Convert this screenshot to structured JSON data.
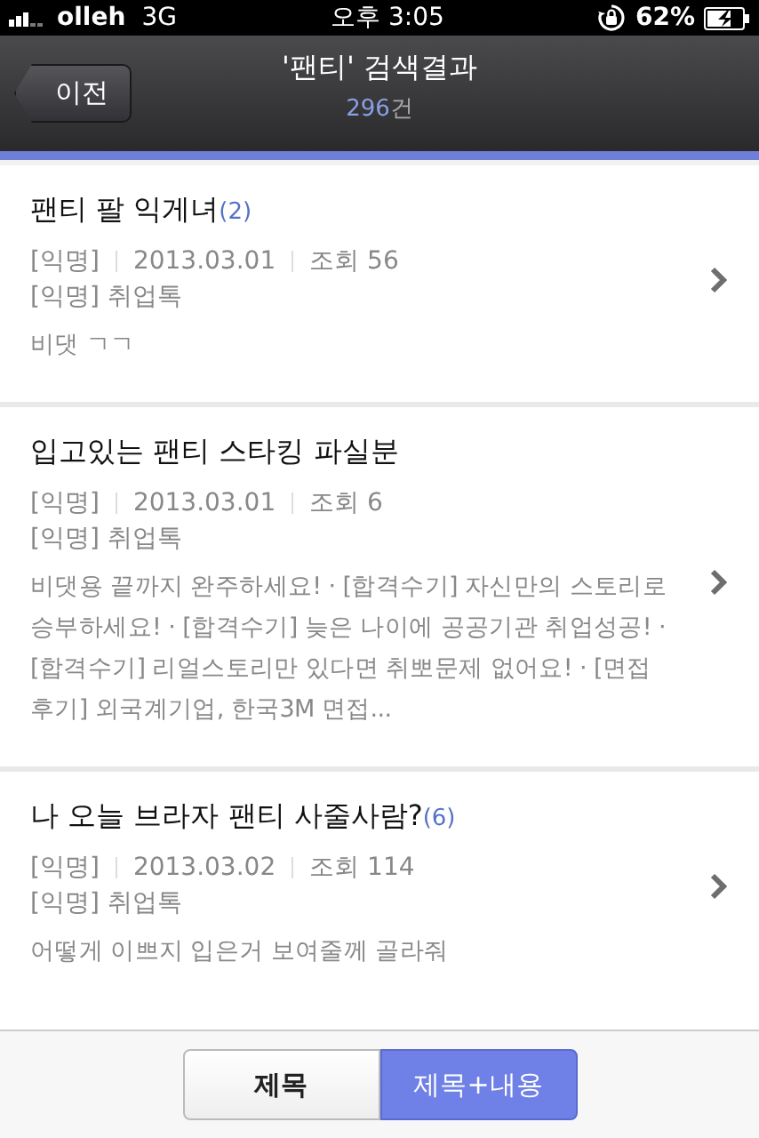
{
  "status_bar": {
    "carrier": "olleh",
    "network": "3G",
    "time": "오후 3:05",
    "battery": "62%"
  },
  "nav_bar": {
    "back": "이전",
    "title": "'팬티' 검색결과",
    "count": "296",
    "count_unit": "건"
  },
  "results": [
    {
      "title": "팬티 팔 익게녀",
      "comments": "(2)",
      "author": "[익명]",
      "date": "2013.03.01",
      "views": "조회 56",
      "board": "[익명] 취업톡",
      "snippet": "비댓 ㄱㄱ"
    },
    {
      "title": "입고있는 팬티 스타킹 파실분",
      "author": "[익명]",
      "date": "2013.03.01",
      "views": "조회 6",
      "board": "[익명] 취업톡",
      "snippet": "비댓용 끝까지 완주하세요! · [합격수기] 자신만의 스토리로 승부하세요! · [합격수기] 늦은 나이에 공공기관 취업성공! · [합격수기] 리얼스토리만 있다면 취뽀문제 없어요! · [면접후기] 외국계기업, 한국3M 면접..."
    },
    {
      "title": "나 오늘 브라자 팬티 사줄사람?",
      "comments": "(6)",
      "author": "[익명]",
      "date": "2013.03.02",
      "views": "조회 114",
      "board": "[익명] 취업톡",
      "snippet": "어떻게 이쁘지 입은거 보여줄께 골라줘"
    }
  ],
  "search_scope": [
    {
      "label": "제목",
      "selected": false
    },
    {
      "label": "제목+내용",
      "selected": true
    }
  ]
}
